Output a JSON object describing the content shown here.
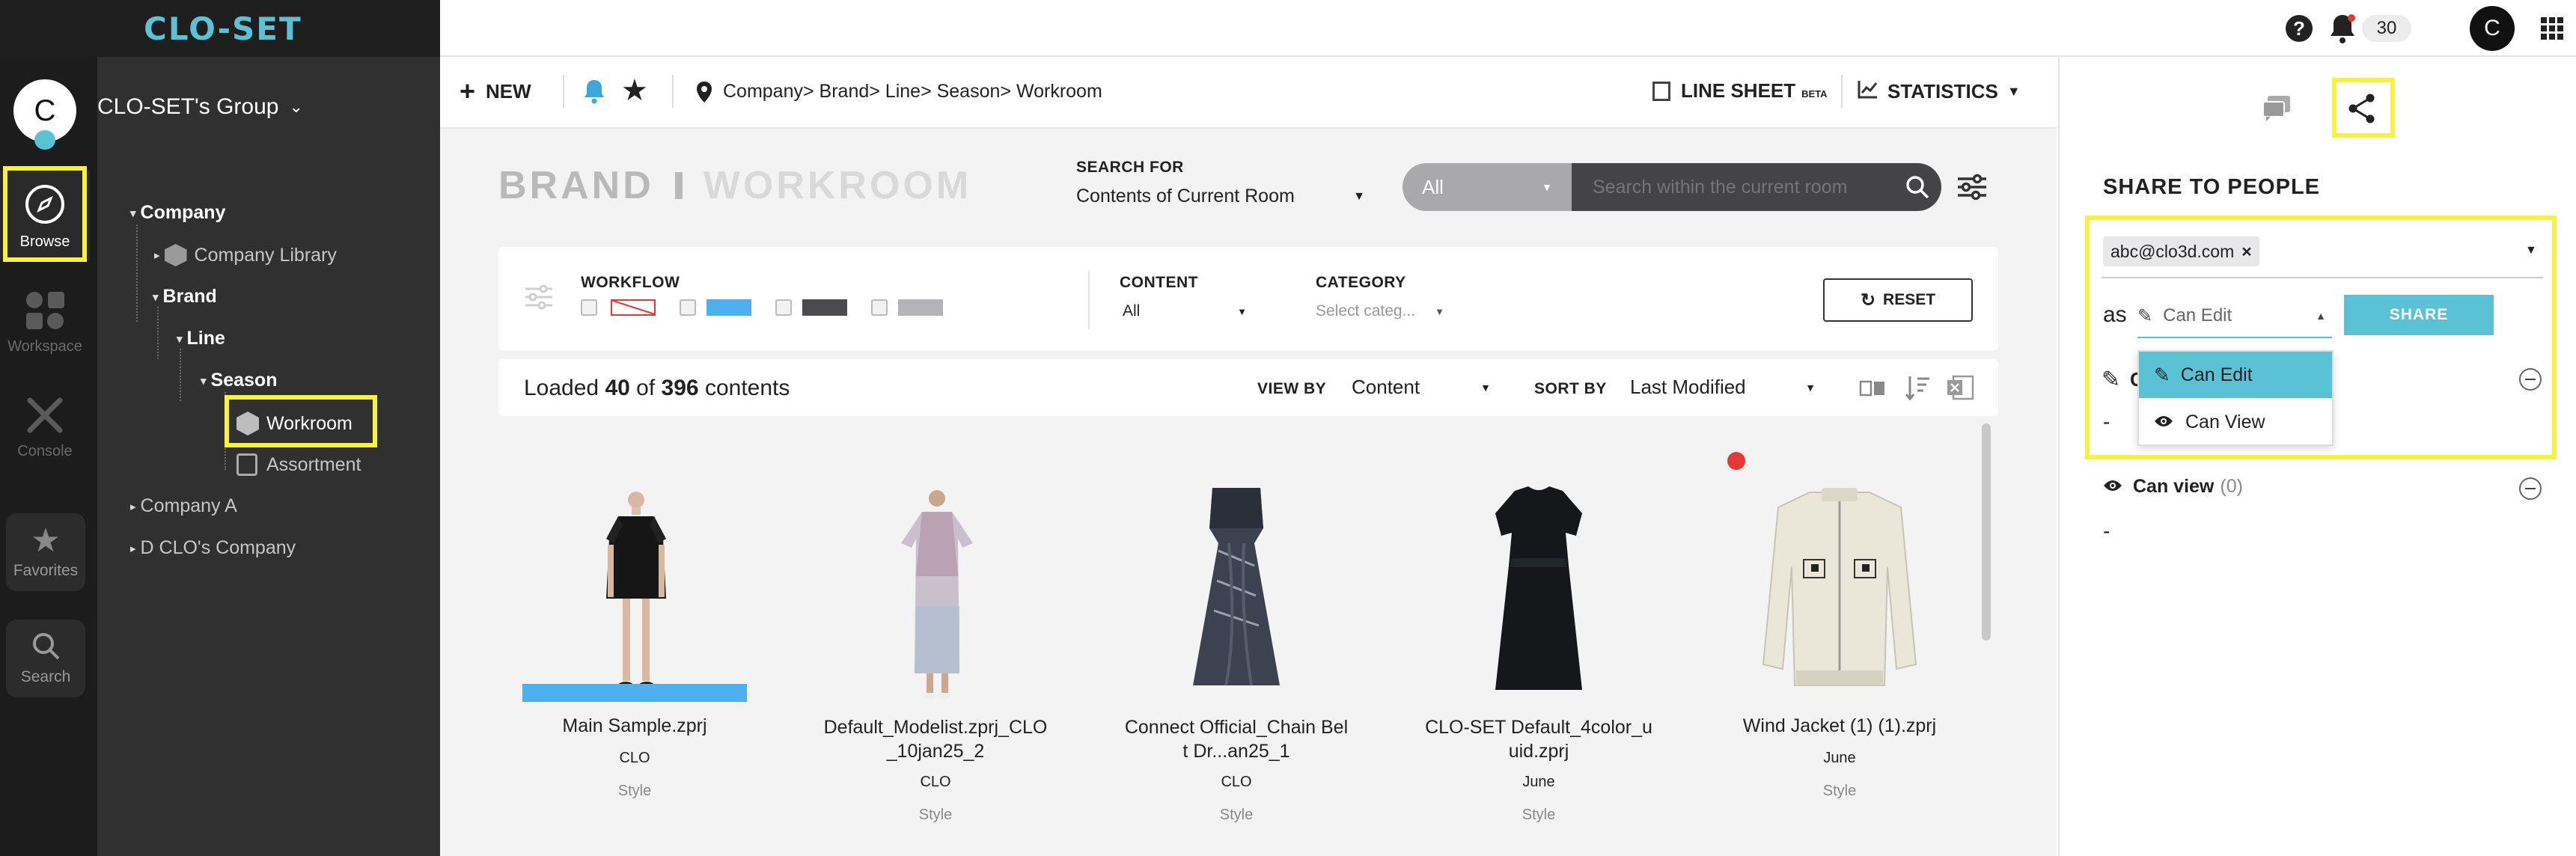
{
  "app": {
    "logo": "CLO-SET"
  },
  "topbar": {
    "notification_count": "30",
    "user_initial": "C"
  },
  "sidebar": {
    "group_name": "CLO-SET's Group",
    "avatar_initial": "C",
    "nav": [
      {
        "label": "Browse"
      },
      {
        "label": "Workspace"
      },
      {
        "label": "Console"
      },
      {
        "label": "Favorites"
      },
      {
        "label": "Search"
      }
    ]
  },
  "tree": {
    "items": [
      "Company",
      "Company Library",
      "Brand",
      "Line",
      "Season",
      "Workroom",
      "Assortment",
      "Company A",
      "D CLO's Company"
    ]
  },
  "toolbar": {
    "new_label": "NEW",
    "breadcrumb": "Company> Brand> Line> Season> Workroom",
    "line_sheet_label": "LINE SHEET",
    "beta_label": "BETA",
    "statistics_label": "STATISTICS"
  },
  "header": {
    "brand": "BRAND",
    "room": "WORKROOM"
  },
  "search": {
    "for_label": "SEARCH FOR",
    "for_value": "Contents of Current Room",
    "scope_value": "All",
    "placeholder": "Search within the current room"
  },
  "filters": {
    "workflow_label": "WORKFLOW",
    "workflow_colors": [
      "#e03a3a",
      "#4fb0f0",
      "#4b4b4f",
      "#b4b4b8"
    ],
    "content_label": "CONTENT",
    "content_value": "All",
    "category_label": "CATEGORY",
    "category_placeholder": "Select categ...",
    "reset_label": "RESET"
  },
  "listbar": {
    "loaded_prefix": "Loaded",
    "loaded_count": "40",
    "of_label": "of",
    "total_count": "396",
    "contents_label": "contents",
    "view_by_label": "VIEW BY",
    "view_by_value": "Content",
    "sort_by_label": "SORT BY",
    "sort_by_value": "Last Modified"
  },
  "items": [
    {
      "name": "Main Sample.zprj",
      "owner": "CLO",
      "type": "Style"
    },
    {
      "name_line1": "Default_Modelist.zprj_CLO",
      "name_line2": "_10jan25_2",
      "owner": "CLO",
      "type": "Style"
    },
    {
      "name_line1": "Connect Official_Chain Bel",
      "name_line2": "t Dr...an25_1",
      "owner": "CLO",
      "type": "Style"
    },
    {
      "name_line1": "CLO-SET Default_4color_u",
      "name_line2": "uid.zprj",
      "owner": "June",
      "type": "Style"
    },
    {
      "name": "Wind Jacket (1) (1).zprj",
      "owner": "June",
      "type": "Style"
    }
  ],
  "share": {
    "title": "SHARE TO PEOPLE",
    "email_chip": "abc@clo3d.com",
    "as_label": "as",
    "permission_value": "Can Edit",
    "share_button": "SHARE",
    "options": [
      "Can Edit",
      "Can View"
    ],
    "can_view_label": "Can view",
    "can_view_count": "(0)",
    "edit_dash": "-",
    "view_dash": "-"
  },
  "colors": {
    "accent": "#5bc2d6",
    "highlight": "#f6f23e",
    "workflow_bar": "#4fb0f0"
  }
}
